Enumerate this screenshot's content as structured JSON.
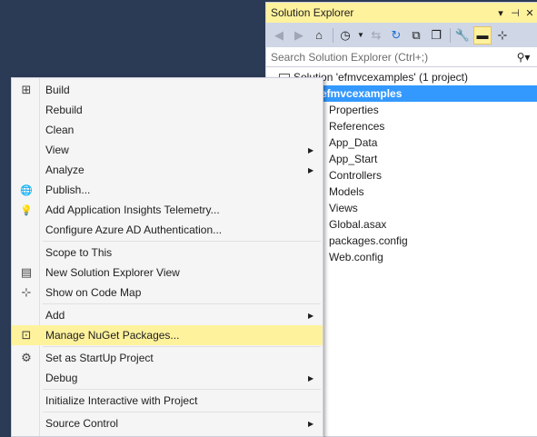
{
  "solution_explorer": {
    "title": "Solution Explorer",
    "title_controls": [
      "▾",
      "⊣",
      "✕"
    ],
    "search_placeholder": "Search Solution Explorer (Ctrl+;)",
    "solution_label": "Solution 'efmvcexamples' (1 project)",
    "project_label": "efmvcexamples",
    "children": [
      "Properties",
      "References",
      "App_Data",
      "App_Start",
      "Controllers",
      "Models",
      "Views",
      "Global.asax",
      "packages.config",
      "Web.config"
    ]
  },
  "context_menu": {
    "items": [
      {
        "label": "Build",
        "icon": "build-icon",
        "glyph": "⊞"
      },
      {
        "label": "Rebuild",
        "icon": "",
        "glyph": ""
      },
      {
        "label": "Clean",
        "icon": "",
        "glyph": ""
      },
      {
        "label": "View",
        "icon": "",
        "glyph": "",
        "submenu": true
      },
      {
        "label": "Analyze",
        "icon": "",
        "glyph": "",
        "submenu": true
      },
      {
        "label": "Publish...",
        "icon": "globe-icon",
        "glyph": "🌐"
      },
      {
        "label": "Add Application Insights Telemetry...",
        "icon": "insights-icon",
        "glyph": "💡"
      },
      {
        "label": "Configure Azure AD Authentication...",
        "icon": "",
        "glyph": ""
      },
      {
        "sep": true
      },
      {
        "label": "Scope to This",
        "icon": "",
        "glyph": ""
      },
      {
        "label": "New Solution Explorer View",
        "icon": "new-view-icon",
        "glyph": "▤"
      },
      {
        "label": "Show on Code Map",
        "icon": "code-map-icon",
        "glyph": "⊹"
      },
      {
        "sep": true
      },
      {
        "label": "Add",
        "icon": "",
        "glyph": "",
        "submenu": true
      },
      {
        "label": "Manage NuGet Packages...",
        "icon": "nuget-icon",
        "glyph": "⊡",
        "highlighted": true
      },
      {
        "sep": true
      },
      {
        "label": "Set as StartUp Project",
        "icon": "gear-icon",
        "glyph": "⚙"
      },
      {
        "label": "Debug",
        "icon": "",
        "glyph": "",
        "submenu": true
      },
      {
        "sep": true
      },
      {
        "label": "Initialize Interactive with Project",
        "icon": "",
        "glyph": ""
      },
      {
        "sep": true
      },
      {
        "label": "Source Control",
        "icon": "",
        "glyph": "",
        "submenu": true
      }
    ]
  },
  "colors": {
    "background": "#2b3a55",
    "title_highlight": "#fff29d",
    "selection": "#3399ff",
    "menu_bg": "#f5f5f5"
  }
}
